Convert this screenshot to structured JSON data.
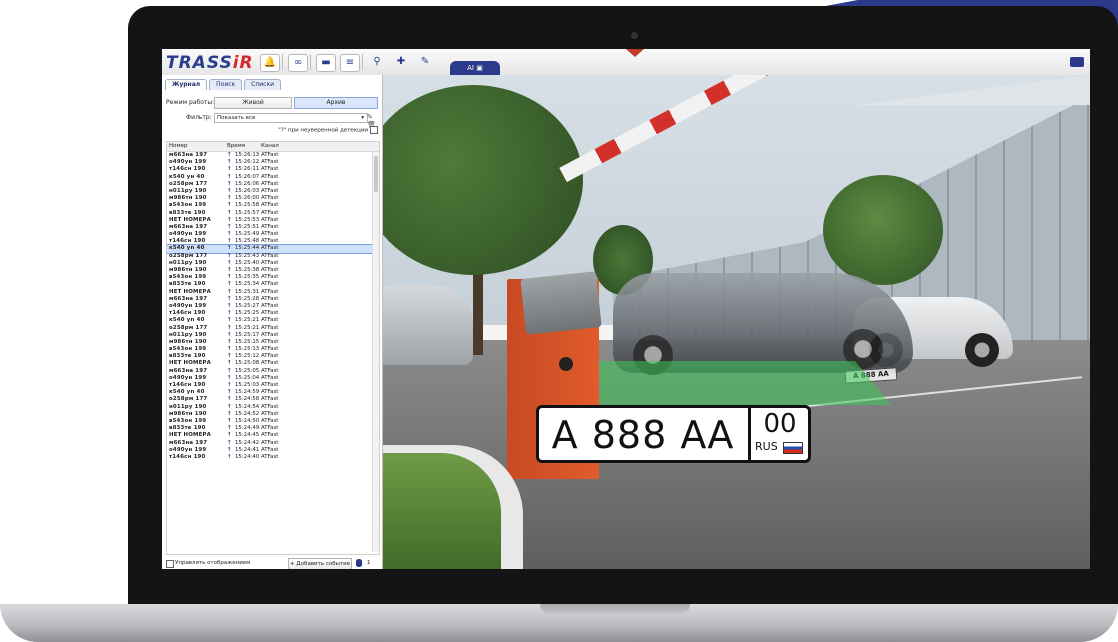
{
  "app": {
    "logo_main": "TRASS",
    "logo_accent": "iR",
    "ai_tab": "AI"
  },
  "panel": {
    "tabs": [
      "Журнал",
      "Поиск",
      "Списки"
    ],
    "mode_label": "Режим работы:",
    "mode_live": "Живой",
    "mode_archive": "Архив",
    "filter_label": "Фильтр:",
    "filter_value": "Показать все",
    "hint": "\"?\" при неуверенной детекции",
    "columns": {
      "plate": "Номер",
      "time": "Время",
      "channel": "Канал"
    },
    "footer_checkbox": "Управлять отображением",
    "add_event": "Добавить событие",
    "count": "1"
  },
  "rows": [
    {
      "plate": "м663на 197",
      "time": "15:26:13",
      "channel": "ATFast"
    },
    {
      "plate": "о490ун 199",
      "time": "15:26:12",
      "channel": "ATFast"
    },
    {
      "plate": "т146сн 190",
      "time": "15:26:11",
      "channel": "ATFast"
    },
    {
      "plate": "к540 ун 40",
      "time": "15:26:07",
      "channel": "ATFast"
    },
    {
      "plate": "о258рм 177",
      "time": "15:26:06",
      "channel": "ATFast"
    },
    {
      "plate": "н011ру 190",
      "time": "15:26:03",
      "channel": "ATFast"
    },
    {
      "plate": "м986тн 190",
      "time": "15:26:00",
      "channel": "ATFast"
    },
    {
      "plate": "в543он 199",
      "time": "15:25:58",
      "channel": "ATFast"
    },
    {
      "plate": "в833те 190",
      "time": "15:25:57",
      "channel": "ATFast"
    },
    {
      "plate": "НЕТ НОМЕРА",
      "time": "15:25:53",
      "channel": "ATFast"
    },
    {
      "plate": "м663на 197",
      "time": "15:25:51",
      "channel": "ATFast"
    },
    {
      "plate": "о490ун 199",
      "time": "15:25:49",
      "channel": "ATFast"
    },
    {
      "plate": "т146сн 190",
      "time": "15:25:48",
      "channel": "ATFast"
    },
    {
      "plate": "к540 уn 40",
      "time": "15:25:44",
      "channel": "ATFast",
      "selected": true
    },
    {
      "plate": "о258рм 177",
      "time": "15:25:43",
      "channel": "ATFast"
    },
    {
      "plate": "н011ру 190",
      "time": "15:25:40",
      "channel": "ATFast"
    },
    {
      "plate": "м986тн 190",
      "time": "15:25:38",
      "channel": "ATFast"
    },
    {
      "plate": "в543он 199",
      "time": "15:25:35",
      "channel": "ATFast"
    },
    {
      "plate": "в833те 190",
      "time": "15:25:34",
      "channel": "ATFast"
    },
    {
      "plate": "НЕТ НОМЕРА",
      "time": "15:25:31",
      "channel": "ATFast"
    },
    {
      "plate": "м663на 197",
      "time": "15:25:28",
      "channel": "ATFast"
    },
    {
      "plate": "о490ун 199",
      "time": "15:25:27",
      "channel": "ATFast"
    },
    {
      "plate": "т146сн 190",
      "time": "15:25:25",
      "channel": "ATFast"
    },
    {
      "plate": "к540 уn 40",
      "time": "15:25:21",
      "channel": "ATFast"
    },
    {
      "plate": "о258рм 177",
      "time": "15:25:21",
      "channel": "ATFast"
    },
    {
      "plate": "н011ру 190",
      "time": "15:25:17",
      "channel": "ATFast"
    },
    {
      "plate": "м986тн 190",
      "time": "15:25:15",
      "channel": "ATFast"
    },
    {
      "plate": "в543он 199",
      "time": "15:25:13",
      "channel": "ATFast"
    },
    {
      "plate": "в833те 190",
      "time": "15:25:12",
      "channel": "ATFast"
    },
    {
      "plate": "НЕТ НОМЕРА",
      "time": "15:25:08",
      "channel": "ATFast"
    },
    {
      "plate": "м663на 197",
      "time": "15:25:05",
      "channel": "ATFast"
    },
    {
      "plate": "о490ун 199",
      "time": "15:25:04",
      "channel": "ATFast"
    },
    {
      "plate": "т146сн 190",
      "time": "15:25:03",
      "channel": "ATFast"
    },
    {
      "plate": "к540 уn 40",
      "time": "15:24:59",
      "channel": "ATFast"
    },
    {
      "plate": "о258рм 177",
      "time": "15:24:58",
      "channel": "ATFast"
    },
    {
      "plate": "н011ру 190",
      "time": "15:24:54",
      "channel": "ATFast"
    },
    {
      "plate": "м986тн 190",
      "time": "15:24:52",
      "channel": "ATFast"
    },
    {
      "plate": "в543он 199",
      "time": "15:24:50",
      "channel": "ATFast"
    },
    {
      "plate": "в833те 190",
      "time": "15:24:49",
      "channel": "ATFast"
    },
    {
      "plate": "НЕТ НОМЕРА",
      "time": "15:24:45",
      "channel": "ATFast"
    },
    {
      "plate": "м663на 197",
      "time": "15:24:42",
      "channel": "ATFast"
    },
    {
      "plate": "о490ун 199",
      "time": "15:24:41",
      "channel": "ATFast"
    },
    {
      "plate": "т146сн 190",
      "time": "15:24:40",
      "channel": "ATFast"
    }
  ],
  "plate_overlay": {
    "main": "А 888 АА",
    "region": "00",
    "country": "RUS"
  },
  "plate_small": "А 888 АА",
  "colors": {
    "brand": "#2b3a8a",
    "accent": "#d6272a",
    "detect_zone": "#3cc85a",
    "barrier": "#e15b2c"
  },
  "icons": [
    "bell-icon",
    "infinity-icon",
    "chat-icon",
    "list-icon",
    "search-icon",
    "puzzle-icon",
    "image-edit-icon",
    "video-camera-icon",
    "pencil-icon",
    "trash-icon",
    "database-icon",
    "plus-icon"
  ]
}
